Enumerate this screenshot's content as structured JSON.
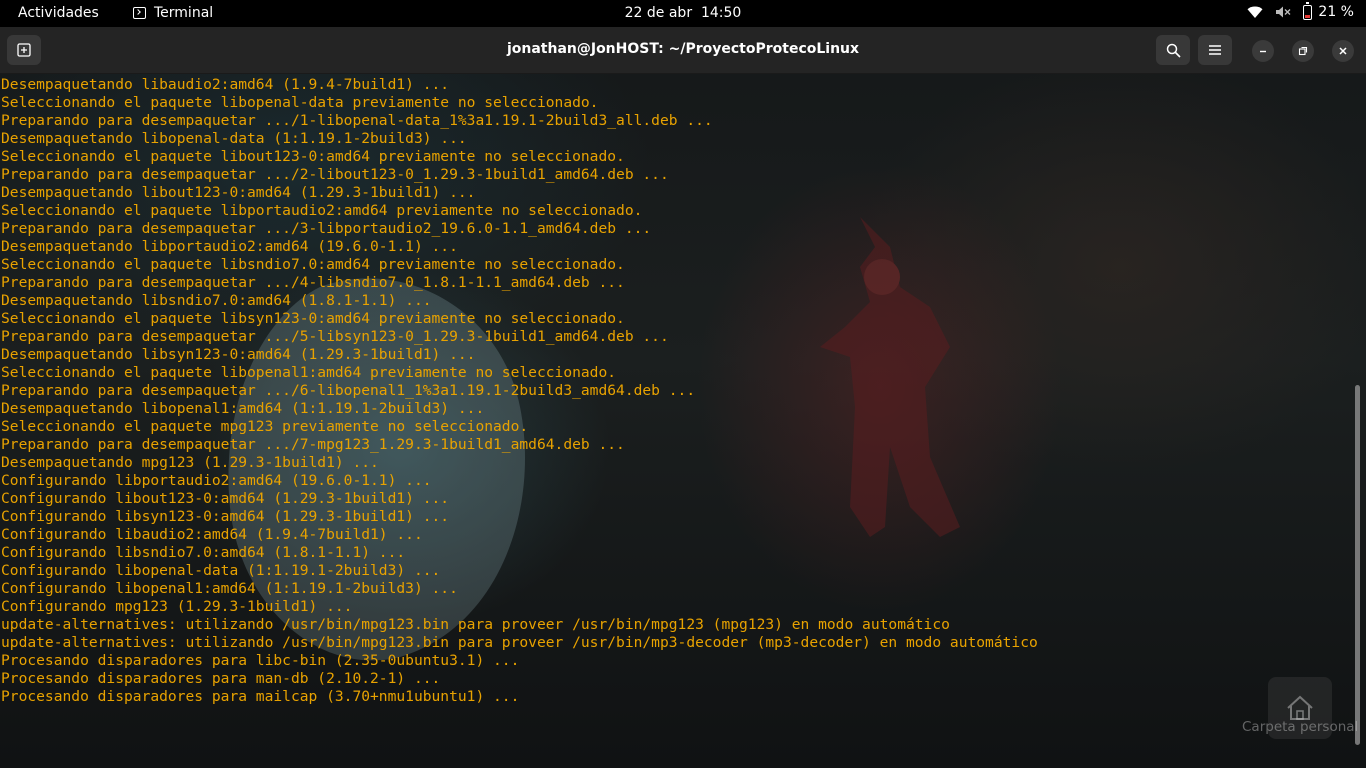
{
  "topbar": {
    "activities": "Actividades",
    "app_name": "Terminal",
    "date": "22 de abr",
    "time": "14:50",
    "battery": "21 %",
    "icons": [
      "wifi-icon",
      "volume-muted-icon",
      "battery-icon"
    ]
  },
  "window": {
    "title": "jonathan@JonHOST: ~/ProyectoProtecoLinux",
    "buttons": [
      "new-tab-icon",
      "search-icon",
      "hamburger-menu-icon",
      "minimize-icon",
      "maximize-icon",
      "close-icon"
    ]
  },
  "terminal": {
    "text_color": "#e8a200",
    "lines": [
      "Desempaquetando libaudio2:amd64 (1.9.4-7build1) ...",
      "Seleccionando el paquete libopenal-data previamente no seleccionado.",
      "Preparando para desempaquetar .../1-libopenal-data_1%3a1.19.1-2build3_all.deb ...",
      "Desempaquetando libopenal-data (1:1.19.1-2build3) ...",
      "Seleccionando el paquete libout123-0:amd64 previamente no seleccionado.",
      "Preparando para desempaquetar .../2-libout123-0_1.29.3-1build1_amd64.deb ...",
      "Desempaquetando libout123-0:amd64 (1.29.3-1build1) ...",
      "Seleccionando el paquete libportaudio2:amd64 previamente no seleccionado.",
      "Preparando para desempaquetar .../3-libportaudio2_19.6.0-1.1_amd64.deb ...",
      "Desempaquetando libportaudio2:amd64 (19.6.0-1.1) ...",
      "Seleccionando el paquete libsndio7.0:amd64 previamente no seleccionado.",
      "Preparando para desempaquetar .../4-libsndio7.0_1.8.1-1.1_amd64.deb ...",
      "Desempaquetando libsndio7.0:amd64 (1.8.1-1.1) ...",
      "Seleccionando el paquete libsyn123-0:amd64 previamente no seleccionado.",
      "Preparando para desempaquetar .../5-libsyn123-0_1.29.3-1build1_amd64.deb ...",
      "Desempaquetando libsyn123-0:amd64 (1.29.3-1build1) ...",
      "Seleccionando el paquete libopenal1:amd64 previamente no seleccionado.",
      "Preparando para desempaquetar .../6-libopenal1_1%3a1.19.1-2build3_amd64.deb ...",
      "Desempaquetando libopenal1:amd64 (1:1.19.1-2build3) ...",
      "Seleccionando el paquete mpg123 previamente no seleccionado.",
      "Preparando para desempaquetar .../7-mpg123_1.29.3-1build1_amd64.deb ...",
      "Desempaquetando mpg123 (1.29.3-1build1) ...",
      "Configurando libportaudio2:amd64 (19.6.0-1.1) ...",
      "Configurando libout123-0:amd64 (1.29.3-1build1) ...",
      "Configurando libsyn123-0:amd64 (1.29.3-1build1) ...",
      "Configurando libaudio2:amd64 (1.9.4-7build1) ...",
      "Configurando libsndio7.0:amd64 (1.8.1-1.1) ...",
      "Configurando libopenal-data (1:1.19.1-2build3) ...",
      "Configurando libopenal1:amd64 (1:1.19.1-2build3) ...",
      "Configurando mpg123 (1.29.3-1build1) ...",
      "update-alternatives: utilizando /usr/bin/mpg123.bin para proveer /usr/bin/mpg123 (mpg123) en modo automático",
      "update-alternatives: utilizando /usr/bin/mpg123.bin para proveer /usr/bin/mp3-decoder (mp3-decoder) en modo automático",
      "Procesando disparadores para libc-bin (2.35-0ubuntu3.1) ...",
      "Procesando disparadores para man-db (2.10.2-1) ...",
      "Procesando disparadores para mailcap (3.70+nmu1ubuntu1) ..."
    ]
  },
  "desktop": {
    "home_folder_label": "Carpeta personal",
    "home_folder_icon": "home-folder-icon"
  }
}
